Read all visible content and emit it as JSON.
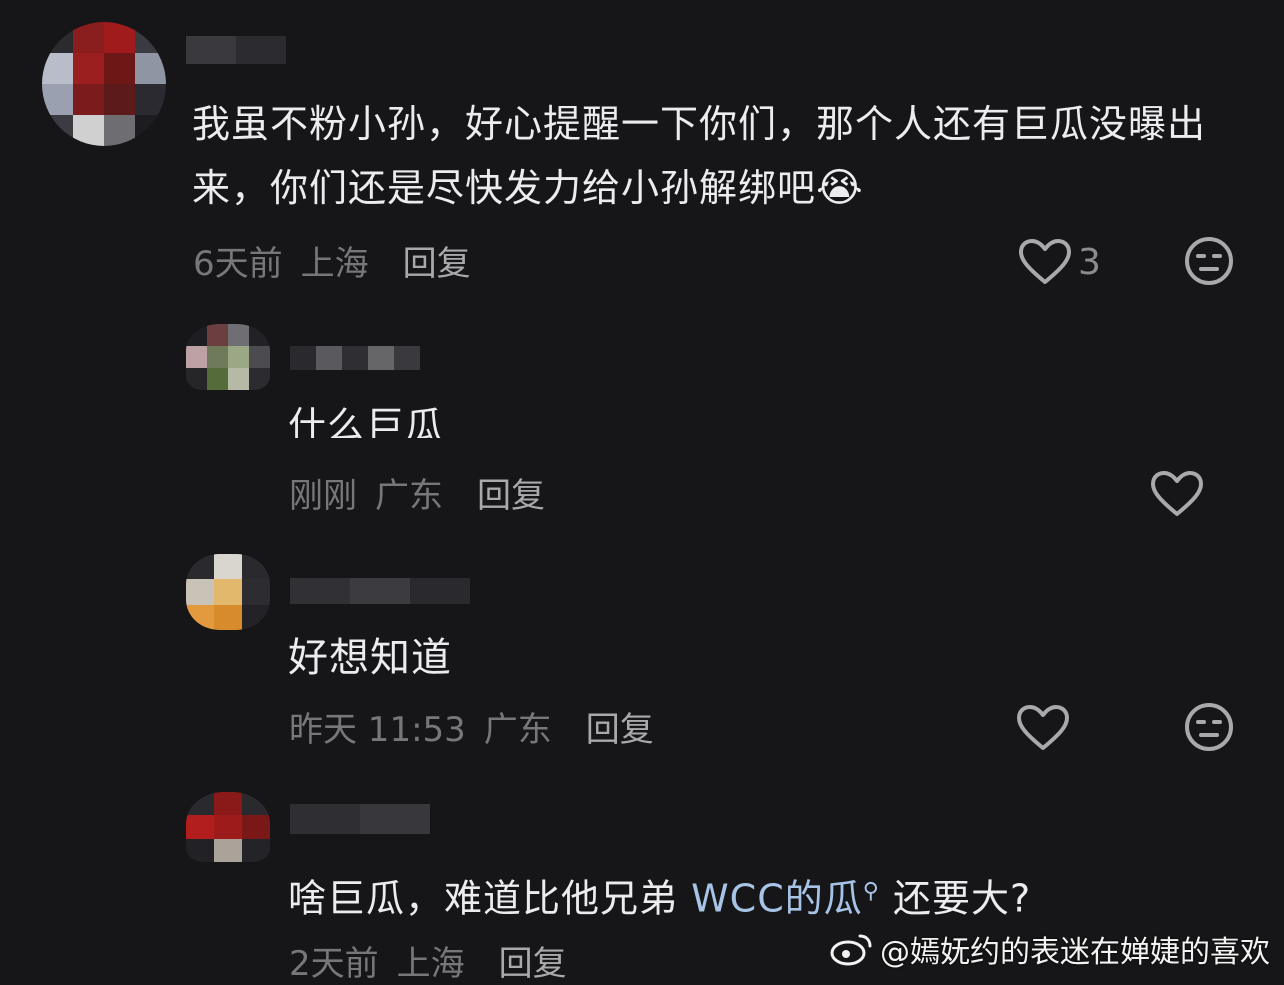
{
  "comments": [
    {
      "text": "我虽不粉小孙，好心提醒一下你们，那个人还有巨瓜没曝出来，你们还是尽快发力给小孙解绑吧",
      "emoji": "😭",
      "time": "6天前",
      "location": "上海",
      "reply_label": "回复",
      "like_count": "3"
    },
    {
      "text": "什么巨瓜",
      "time": "刚刚",
      "location": "广东",
      "reply_label": "回复"
    },
    {
      "text": "好想知道",
      "time": "昨天 11:53",
      "location": "广东",
      "reply_label": "回复"
    },
    {
      "text_before": "啥巨瓜，难道比他兄弟 ",
      "link_text": "WCC的瓜",
      "text_after": " 还要大?",
      "time": "2天前",
      "location": "上海",
      "reply_label": "回复"
    }
  ],
  "watermark": {
    "text": "@嫣妩约的表迷在婵婕的喜欢",
    "icon": "weibo-icon"
  },
  "colors": {
    "background": "#161618",
    "text": "#ececee",
    "meta": "#77777b",
    "link": "#a7c4e6"
  }
}
